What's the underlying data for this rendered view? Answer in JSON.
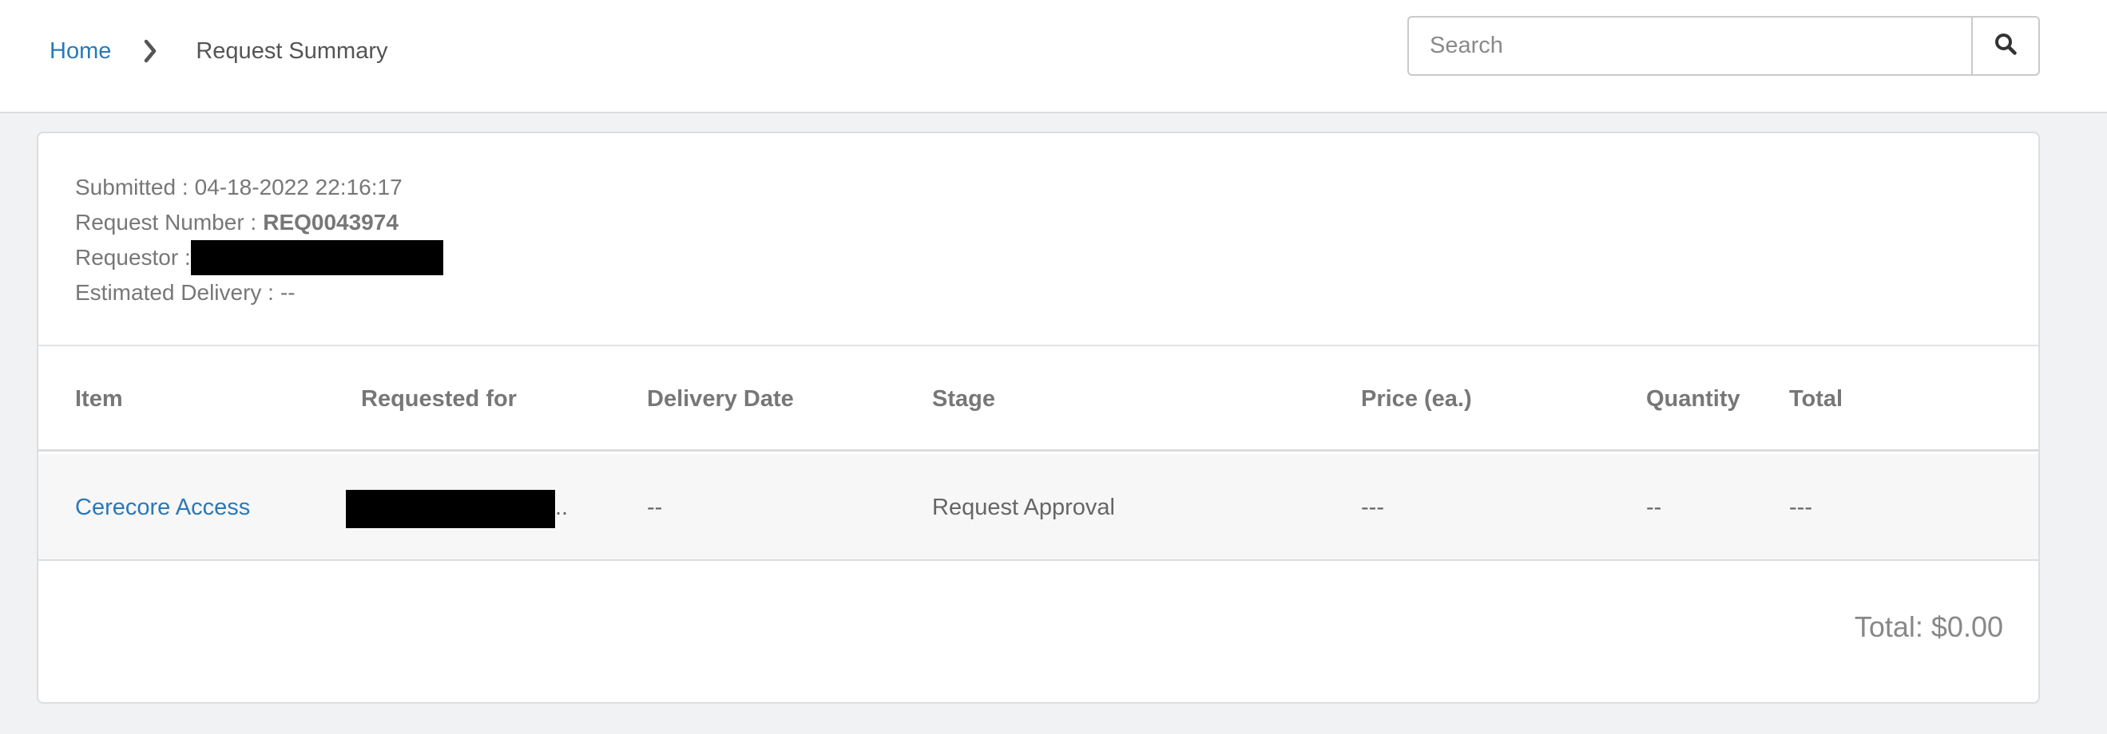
{
  "breadcrumb": {
    "home": "Home",
    "current": "Request Summary"
  },
  "search": {
    "placeholder": "Search"
  },
  "request": {
    "submitted_label": "Submitted :",
    "submitted_value": "04-18-2022 22:16:17",
    "number_label": "Request Number :",
    "number_value": "REQ0043974",
    "requestor_label": "Requestor :",
    "delivery_label": "Estimated Delivery :",
    "delivery_value": "--"
  },
  "table": {
    "columns": [
      "Item",
      "Requested for",
      "Delivery Date",
      "Stage",
      "Price (ea.)",
      "Quantity",
      "Total"
    ],
    "rows": [
      {
        "item": "Cerecore Access",
        "requested_for_suffix": "..",
        "delivery_date": "--",
        "stage": "Request Approval",
        "price": "---",
        "quantity": "--",
        "total": "---"
      }
    ]
  },
  "summary": {
    "total": "Total: $0.00"
  },
  "icons": {
    "breadcrumb_separator": "chevron-right-icon",
    "search": "search-icon"
  }
}
